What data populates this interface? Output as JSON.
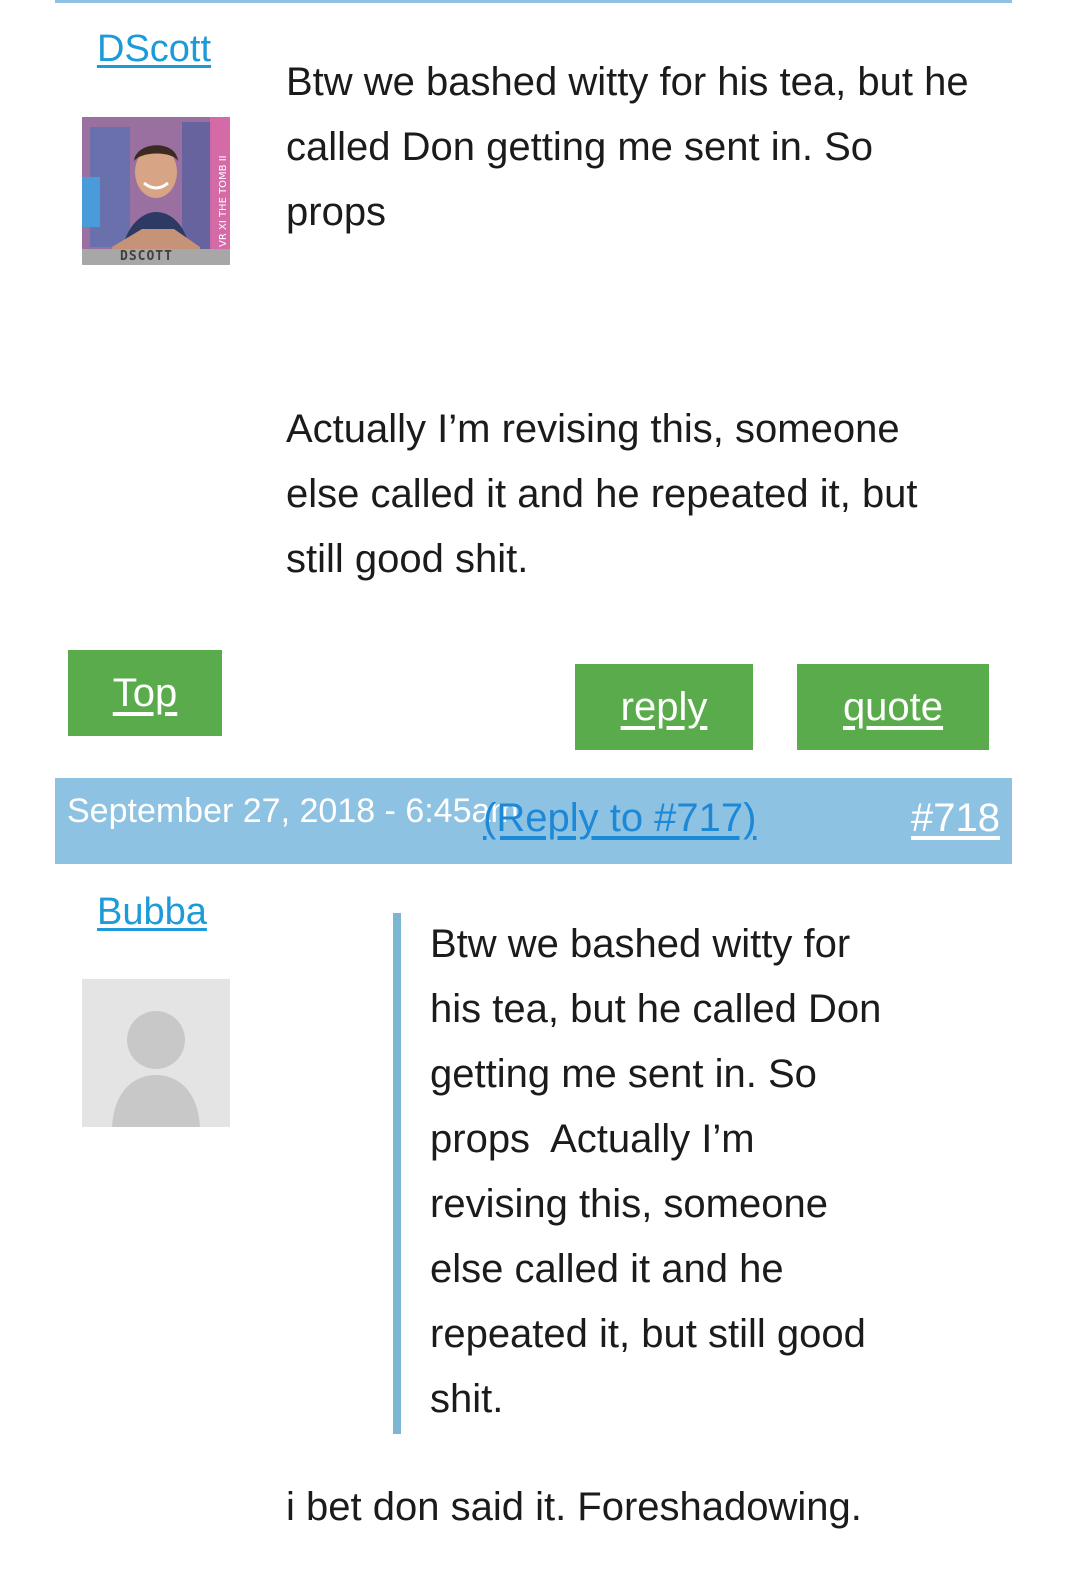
{
  "post1": {
    "author": "DScott",
    "avatar_caption": "DSCOTT",
    "avatar_side_text": "VR XI THE TOMB II",
    "paragraph1": [
      "Btw we bashed witty for his tea, but he",
      "called Don getting me sent in. So",
      "props"
    ],
    "paragraph2": [
      "Actually I’m revising this, someone",
      "else called it and he repeated it, but",
      "still good shit."
    ],
    "top_button": "Top",
    "reply_button": "reply",
    "quote_button": "quote"
  },
  "post2": {
    "date": "September 27, 2018 - 6:45am",
    "reply_to": "(Reply to #717)",
    "post_number": "#718",
    "author": "Bubba",
    "quote_lines": [
      "Btw we bashed witty for",
      "his tea, but he called Don",
      "getting me sent in. So",
      "props  Actually I’m",
      "revising this, someone",
      "else called it and he",
      "repeated it, but still good",
      "shit."
    ],
    "body": "i bet don said it. Foreshadowing."
  },
  "colors": {
    "link": "#1d9bd8",
    "meta_bar": "#8ec2e2",
    "button": "#5aab4b",
    "quote_border": "#7bb6d3"
  },
  "icons": {
    "avatar1": "user-photo-avatar",
    "avatar2": "default-user-icon"
  }
}
